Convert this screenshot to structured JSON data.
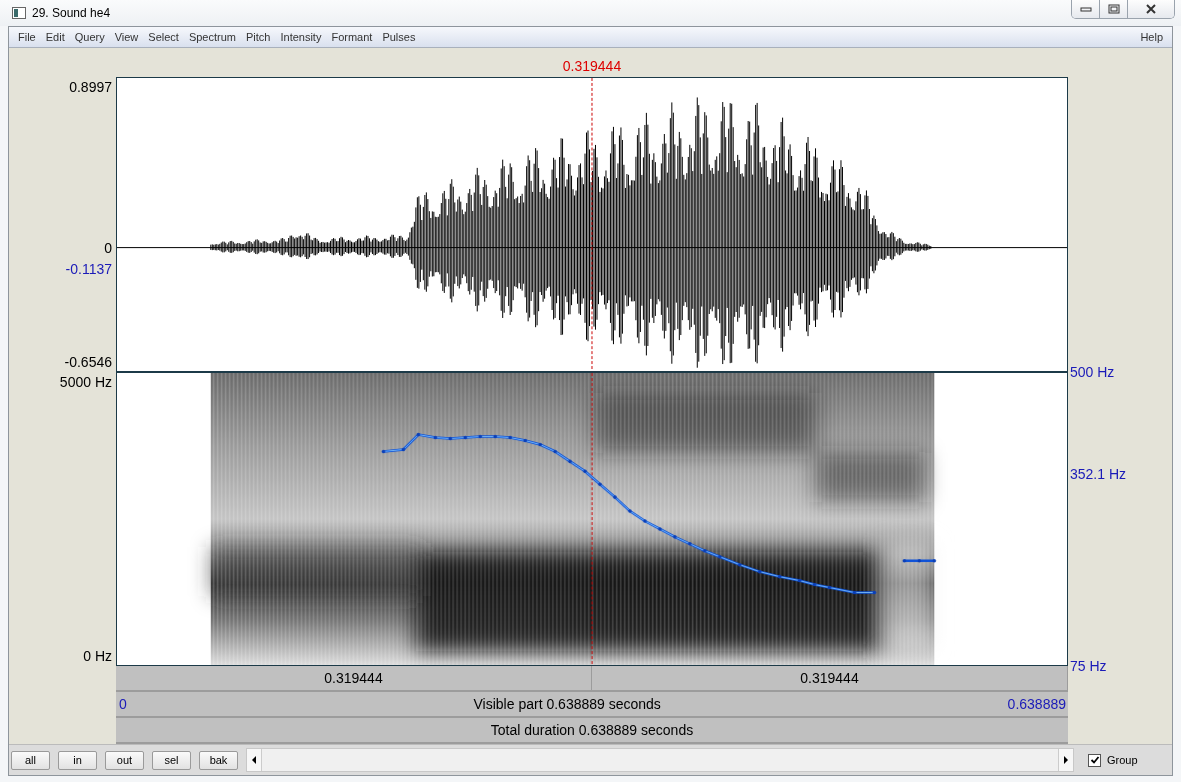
{
  "window": {
    "title": "29. Sound he4"
  },
  "menu": [
    "File",
    "Edit",
    "Query",
    "View",
    "Select",
    "Spectrum",
    "Pitch",
    "Intensity",
    "Formant",
    "Pulses"
  ],
  "help_menu": "Help",
  "cursor_time": "0.319444",
  "waveform": {
    "labels": [
      {
        "label": "0.8997",
        "kind": "max"
      },
      {
        "label": "0",
        "kind": "zero"
      },
      {
        "label": "-0.1137",
        "kind": "cursor"
      },
      {
        "label": "-0.6546",
        "kind": "min"
      }
    ]
  },
  "spectrogram": {
    "left_labels": [
      {
        "label": "5000 Hz",
        "kind": "top"
      },
      {
        "label": "0 Hz",
        "kind": "bottom"
      }
    ],
    "right_labels": [
      {
        "label": "500 Hz",
        "kind": "top"
      },
      {
        "label": "352.1 Hz",
        "kind": "mid"
      },
      {
        "label": "75 Hz",
        "kind": "bottom"
      }
    ]
  },
  "time_rows": {
    "left_segment": "0.319444",
    "right_segment": "0.319444",
    "visible_start": "0",
    "visible": "Visible part 0.638889 seconds",
    "visible_end": "0.638889",
    "total": "Total duration 0.638889 seconds"
  },
  "buttons": [
    "all",
    "in",
    "out",
    "sel",
    "bak"
  ],
  "group": {
    "label": "Group",
    "checked": true
  }
}
